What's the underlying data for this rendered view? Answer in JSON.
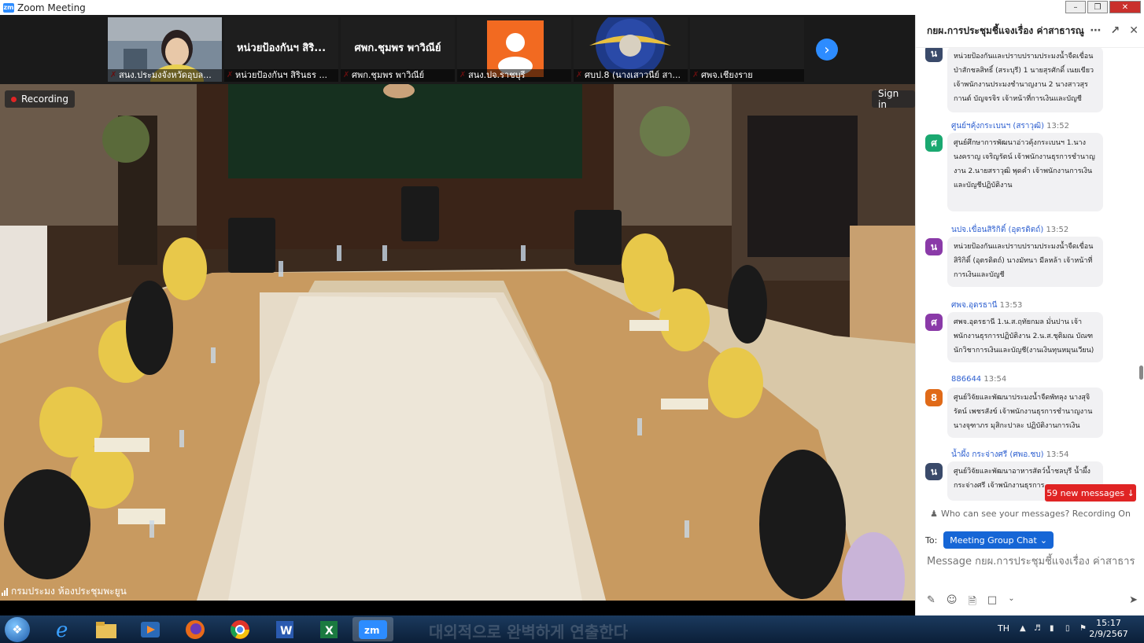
{
  "window": {
    "title": "Zoom Meeting",
    "app_icon": "zm",
    "controls": [
      "minimize",
      "restore",
      "close"
    ]
  },
  "participants": [
    {
      "name": "สนง.ประมงจังหวัดอุบล...",
      "type": "video"
    },
    {
      "name": "หน่วยป้องกันฯ สิรินธร ...",
      "big_label": "หน่วยป้องกันฯ สิริ...",
      "type": "name"
    },
    {
      "name": "ศพก.ชุมพร พาวิณีย์",
      "big_label": "ศพก.ชุมพร พาวิณีย์",
      "type": "name"
    },
    {
      "name": "สนง.ปจ.ราชบุรี",
      "type": "avatar",
      "avatar_color": "#f26a21"
    },
    {
      "name": "ศบป.8 (นางเสาวนีย์ สา...",
      "type": "logo",
      "logo_text": "DEPARTMENT OF FISHERIES"
    },
    {
      "name": "ศพจ.เชียงราย",
      "type": "name"
    }
  ],
  "recording": {
    "label": "Recording"
  },
  "signin": {
    "label": "Sign in"
  },
  "room": {
    "label": "กรมประมง ห้องประชุมพะยูน"
  },
  "chat": {
    "title": "กยผ.การประชุมชี้แจงเรื่อง ค่าสาธารณู...",
    "messages": [
      {
        "sender": "",
        "time": "",
        "avatar": "น",
        "avatar_color": "#3a4a6a",
        "text": "หน่วยป้องกันและปราบปรามประมงน้ำจืดเขื่อนป่าสักชลสิทธิ์ (สระบุรี) 1 นายสุรศักดิ์ เนยเขียว เจ้าพนักงานประมงชำนาญงาน 2 นางสาวสุรกานต์ บัญจรจิร เจ้าหน้าที่การเงินและบัญชี"
      },
      {
        "sender": "ศูนย์ฯคุ้งกระเบนฯ (สราวุฒิ)",
        "time": "13:52",
        "avatar": "ศ",
        "avatar_color": "#1aa870",
        "text": "ศูนย์ศึกษาการพัฒนาอ่าวคุ้งกระเบนฯ 1.นางนงคราญ เจริญรัตน์ เจ้าพนักงานธุรการชำนาญงาน 2.นายสราวุฒิ พุดคำ เจ้าพนักงานการเงินและบัญชีปฏิบัติงาน"
      },
      {
        "sender": "นปจ.เขื่อนสิริกิติ์ (อุตรดิตถ์)",
        "time": "13:52",
        "avatar": "น",
        "avatar_color": "#8a3aa8",
        "text": "หน่วยป้องกันและปราบปรามประมงน้ำจืดเขื่อนสิริกิติ์ (อุตรดิตถ์) นางมัทนา มีลหล้า เจ้าหน้าที่การเงินและบัญชี"
      },
      {
        "sender": "ศพจ.อุดรธานี",
        "time": "13:53",
        "avatar": "ศ",
        "avatar_color": "#8a3aa8",
        "text": "ศพจ.อุดรธานี 1.น.ส.ฤทัยกมล มั่นปาน เจ้าพนักงานธุรการปฏิบัติงาน 2.น.ส.ชุติมณ บัณฑ นักวิชาการเงินและบัญชี(งานเงินทุนหมุนเวียน)"
      },
      {
        "sender": "886644",
        "time": "13:54",
        "avatar": "8",
        "avatar_color": "#e06a18",
        "text": "ศูนย์วิจัยและพัฒนาประมงน้ำจืดพัทลุง นางสุจิรัตน์ เพชรสังข์ เจ้าพนักงานธุรการชำนาญงาน นางจุฑาภร มุสิกะปาละ ปฏิบัติงานการเงิน"
      },
      {
        "sender": "น้ำผึ้ง กระจ่างศรี (ศพอ.ชบ)",
        "time": "13:54",
        "avatar": "น",
        "avatar_color": "#3a4a6a",
        "text": "ศูนย์วิจัยและพัฒนาอาหารสัตว์น้ำชลบุรี น้ำผึ้ง กระจ่างศรี เจ้าพนักงานธุรการ"
      }
    ],
    "new_messages": "59 new messages",
    "visibility_note": "Who can see your messages? Recording On",
    "to_label": "To:",
    "to_value": "Meeting Group Chat",
    "input_placeholder": "Message กยผ.การประชุมชี้แจงเรื่อง ค่าสาธารณูป..."
  },
  "taskbar": {
    "apps": [
      "start",
      "internet-explorer",
      "file-explorer",
      "media-player",
      "firefox",
      "chrome",
      "word",
      "excel",
      "zoom"
    ],
    "active": "zoom",
    "ghost_text": "대외적으로 완벽하게 연출한다",
    "language": "TH",
    "time": "15:17",
    "date": "2/9/2567"
  }
}
